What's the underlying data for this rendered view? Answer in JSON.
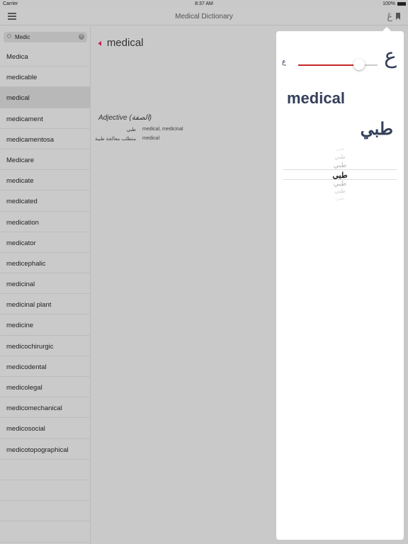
{
  "status": {
    "carrier": "Carrier",
    "time": "8:37 AM",
    "battery": "100%"
  },
  "navbar": {
    "title": "Medical Dictionary",
    "arabic_toggle": "عَ"
  },
  "search": {
    "value": "Medic"
  },
  "list": [
    "Medica",
    "medicable",
    "medical",
    "medicament",
    "medicamentosa",
    "Medicare",
    "medicate",
    "medicated",
    "medication",
    "medicator",
    "medicephalic",
    "medicinal",
    "medicinal plant",
    "medicine",
    "medicochirurgic",
    "medicodental",
    "medicolegal",
    "medicomechanical",
    "medicosocial",
    "medicotopographical"
  ],
  "selected_index": 2,
  "entry": {
    "word": "medical",
    "pos": "Adjective (الصفة)",
    "definitions": [
      {
        "ar": "طبي",
        "en": "medical, medicinal"
      },
      {
        "ar": "متطلب معالجة طبية",
        "en": "medical"
      }
    ]
  },
  "popover": {
    "small_glyph": "ع",
    "large_glyph": "ع",
    "font_size_level": 0.77,
    "preview_en": "medical",
    "preview_ar": "طبي",
    "picker": [
      "طبي",
      "طبي",
      "طبي",
      "طبي",
      "طبي",
      "طبي",
      "طبي"
    ],
    "picker_selected": 3
  },
  "colors": {
    "accent": "#c2185b",
    "slider": "#c62828",
    "preview": "#34405a"
  }
}
